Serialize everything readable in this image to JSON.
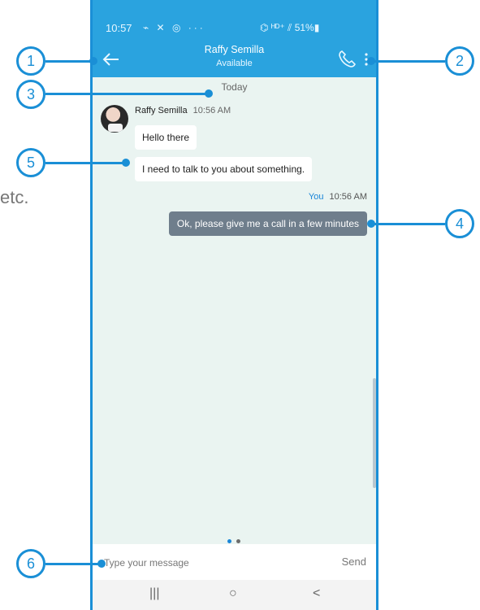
{
  "status_bar": {
    "time": "10:57",
    "icons": "⌁ ✕ ◎ ···",
    "right": "⌬ ᴴᴰ⁺ ⫽ 51%▮"
  },
  "header": {
    "contact_name": "Raffy Semilla",
    "status": "Available"
  },
  "chat": {
    "date_separator": "Today",
    "incoming": {
      "sender": "Raffy Semilla",
      "time": "10:56 AM",
      "messages": [
        "Hello there",
        "I need to talk to you about something."
      ]
    },
    "outgoing": {
      "sender": "You",
      "time": "10:56 AM",
      "message": "Ok, please give me a call in a few minutes"
    }
  },
  "composer": {
    "placeholder": "Type your message",
    "send_label": "Send"
  },
  "nav": {
    "recents": "|||",
    "home": "○",
    "back": "<"
  },
  "annotations": {
    "labels": [
      "1",
      "2",
      "3",
      "4",
      "5",
      "6"
    ],
    "side_text": "etc."
  },
  "colors": {
    "header_bg": "#2aa3df",
    "chat_bg": "#eaf4f1",
    "outgoing_bubble": "#6f7e8c",
    "accent": "#1a86d8",
    "callout": "#1a8fd6"
  }
}
